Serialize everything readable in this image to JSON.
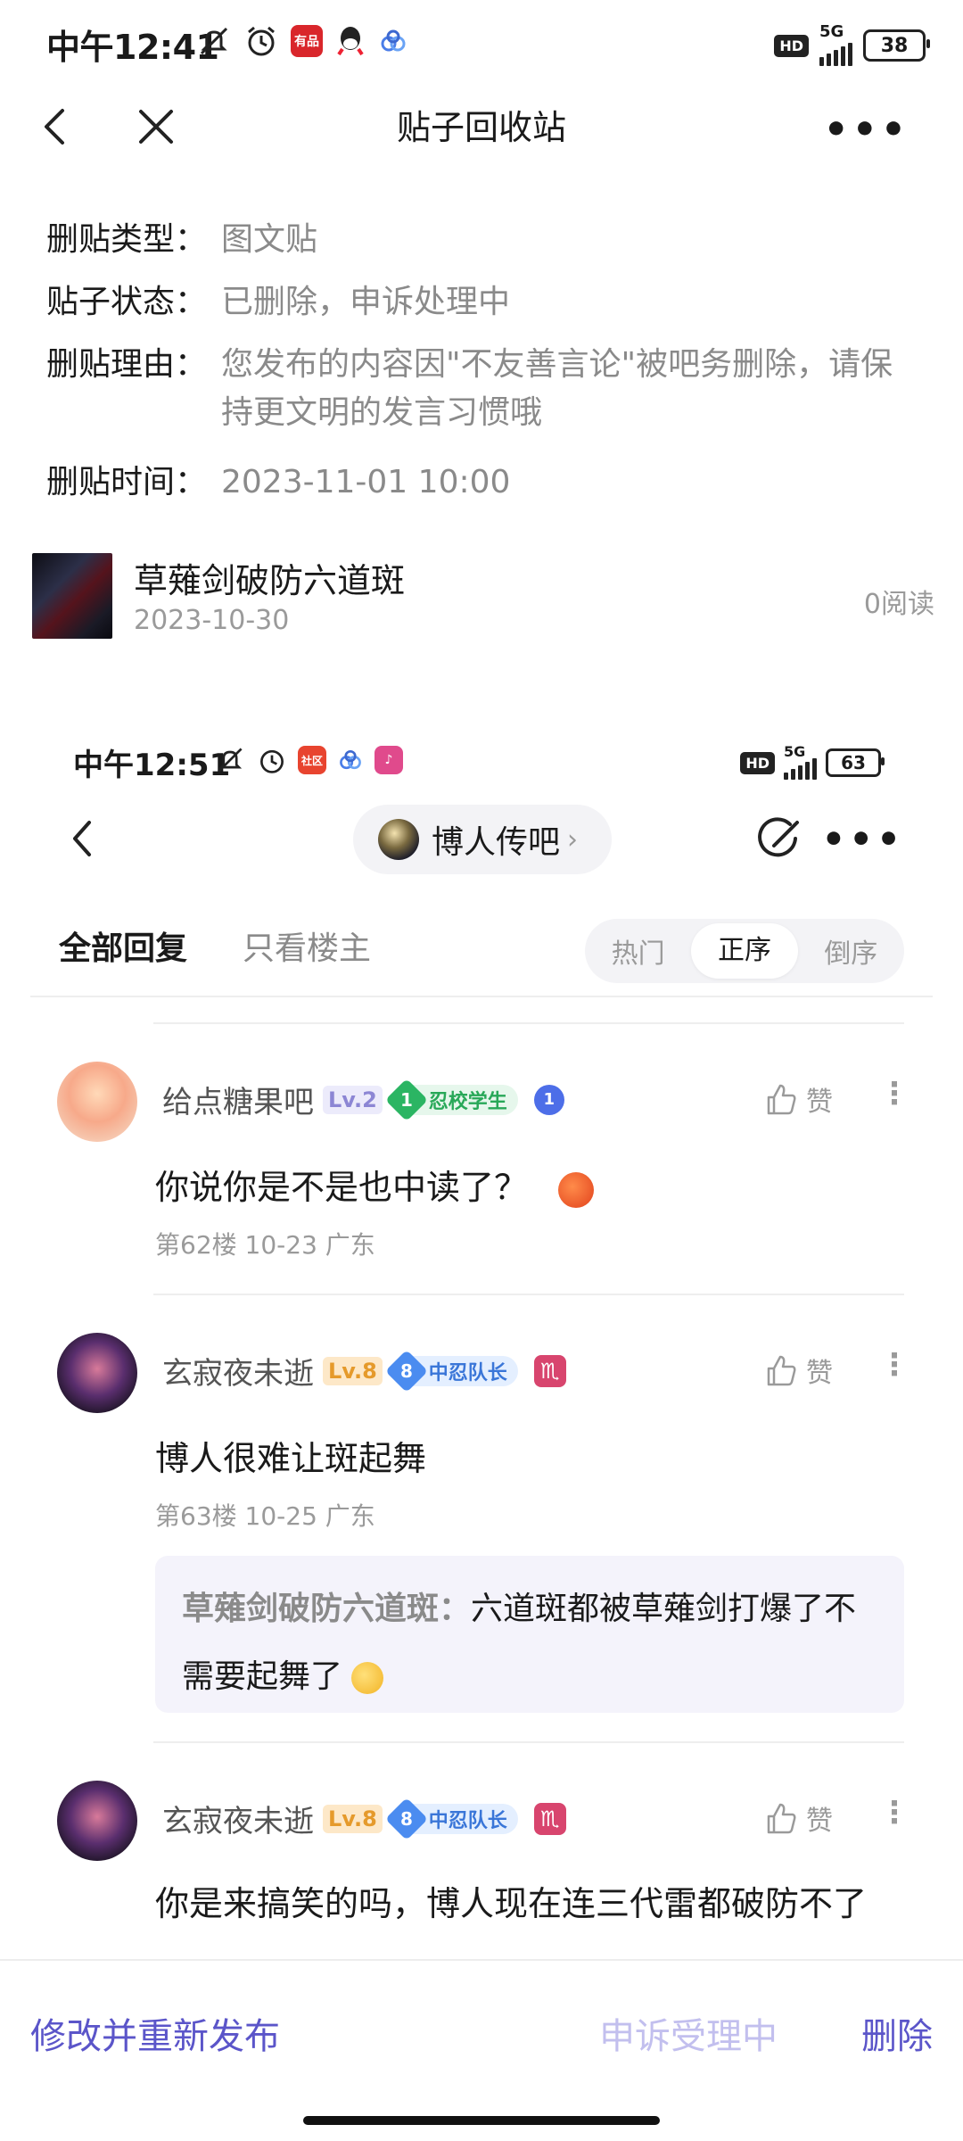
{
  "status_bar": {
    "time": "中午12:41",
    "battery": "38",
    "network": "5G",
    "hd": "HD"
  },
  "header": {
    "title": "贴子回收站"
  },
  "deleted_info": {
    "rows": [
      {
        "key": "删贴类型：",
        "value": "图文贴"
      },
      {
        "key": "贴子状态：",
        "value": "已删除，申诉处理中"
      },
      {
        "key": "删贴理由：",
        "value": "您发布的内容因\"不友善言论\"被吧务删除，请保持更文明的发言习惯哦"
      },
      {
        "key": "删贴时间：",
        "value": "2023-11-01 10:00"
      }
    ]
  },
  "post": {
    "title": "草薙剑破防六道斑",
    "date": "2023-10-30",
    "reads": "0阅读"
  },
  "embedded": {
    "status_bar": {
      "time": "中午12:51",
      "battery": "63",
      "network": "5G",
      "hd": "HD",
      "app_badge": "社区"
    },
    "forum_name": "博人传吧",
    "tabs": {
      "all": "全部回复",
      "op_only": "只看楼主",
      "sort_options": [
        "热门",
        "正序",
        "倒序"
      ],
      "sort_active": "正序"
    },
    "comments": [
      {
        "user": "给点糖果吧",
        "level": "Lv.2",
        "badge_num": "1",
        "badge_text": "忍校学生",
        "extra_badge_num": "1",
        "like_label": "赞",
        "text": "你说你是不是也中读了？",
        "meta": "第62楼  10-23  广东"
      },
      {
        "user": "玄寂夜未逝",
        "level": "Lv.8",
        "badge_num": "8",
        "badge_text": "中忍队长",
        "extra_badge": "♏",
        "like_label": "赞",
        "text": "博人很难让斑起舞",
        "meta": "第63楼  10-25  广东",
        "reply": {
          "author": "草薙剑破防六道斑：",
          "text": "六道斑都被草薙剑打爆了不需要起舞了"
        }
      },
      {
        "user": "玄寂夜未逝",
        "level": "Lv.8",
        "badge_num": "8",
        "badge_text": "中忍队长",
        "extra_badge": "♏",
        "like_label": "赞",
        "text": "你是来搞笑的吗，博人现在连三代雷都破防不了"
      }
    ]
  },
  "bottom_bar": {
    "edit_label": "修改并重新发布",
    "appeal_label": "申诉受理中",
    "delete_label": "删除"
  },
  "colors": {
    "accent": "#5b55c9",
    "accent_disabled": "#c2bfee"
  }
}
